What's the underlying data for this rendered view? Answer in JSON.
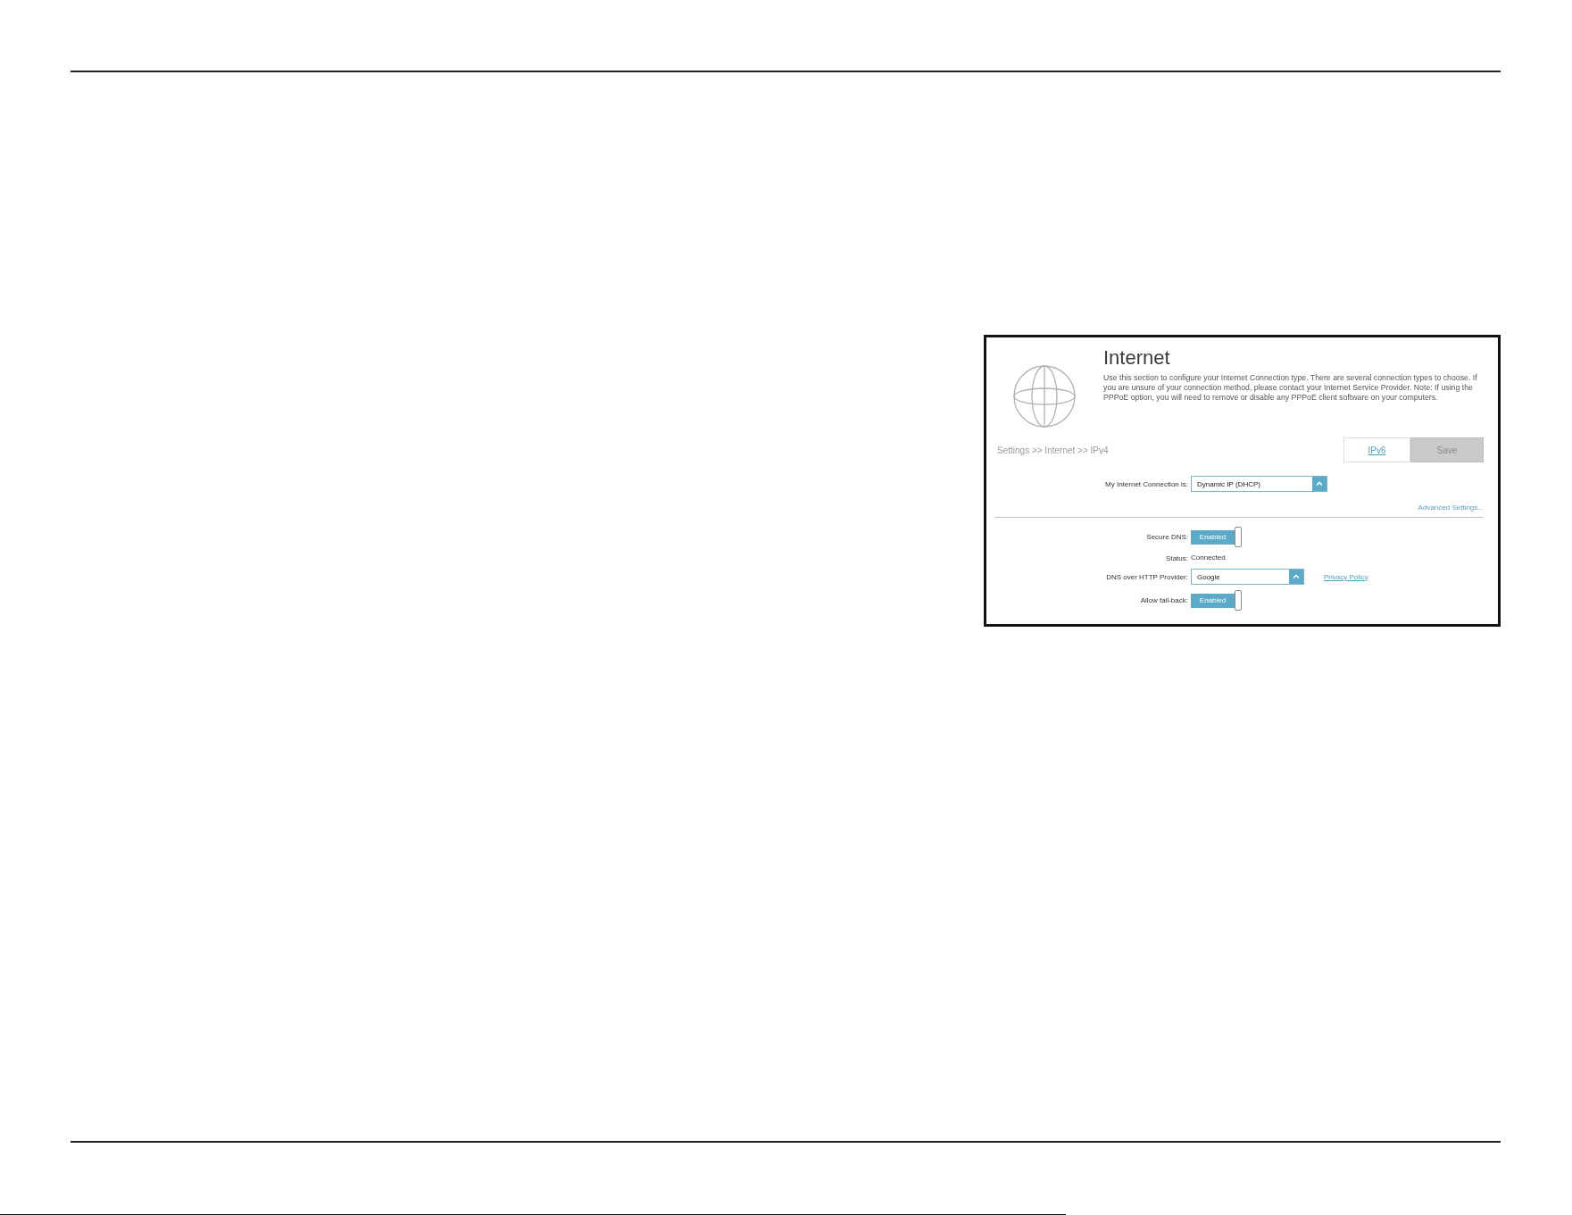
{
  "settings_panel": {
    "title": "Internet",
    "description": "Use this section to configure your Internet Connection type. There are several connection types to choose. If you are unsure of your connection method, please contact your Internet Service Provider. Note: If using the PPPoE option, you will need to remove or disable any PPPoE client software on your computers.",
    "breadcrumb": "Settings >> Internet >> IPv4",
    "ipv6_button": "IPv6",
    "save_button": {
      "label": "Save",
      "disabled": true
    },
    "connection": {
      "kind": "select",
      "label": "My Internet Connection is:",
      "value": "Dynamic IP (DHCP)"
    },
    "advanced_link": "Advanced Settings...",
    "fields": [
      {
        "kind": "toggle",
        "label": "Secure DNS:",
        "value": "Enabled",
        "on": true
      },
      {
        "kind": "text",
        "label": "Status:",
        "value": "Connected"
      },
      {
        "kind": "select",
        "label": "DNS over HTTP Provider:",
        "value": "Google",
        "link": "Privacy Policy"
      },
      {
        "kind": "toggle",
        "label": "Allow fall-back:",
        "value": "Enabled",
        "on": true
      }
    ]
  }
}
